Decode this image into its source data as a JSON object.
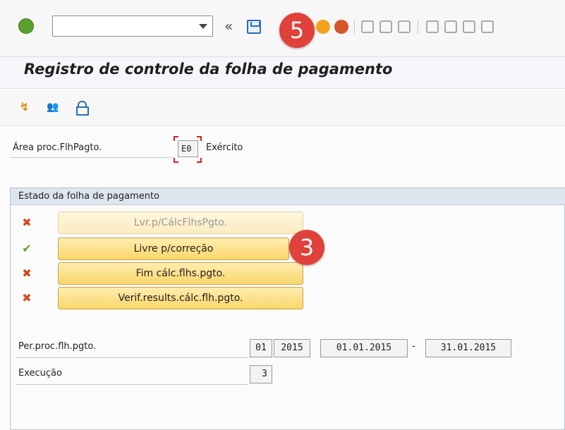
{
  "toolbar": {
    "command_field_value": "",
    "collapse_glyph": "«",
    "icons": [
      "enter-icon",
      "save-icon",
      "back-icon",
      "exit-icon",
      "cancel-icon",
      "print-icon",
      "find-icon",
      "find-next-icon",
      "first-page-icon",
      "previous-page-icon",
      "next-page-icon",
      "last-page-icon"
    ]
  },
  "title": "Registro de controle da folha de pagamento",
  "app_toolbar": {
    "icons": [
      "period-icon",
      "persons-icon",
      "lock-icon"
    ]
  },
  "payroll_area": {
    "label": "Área proc.FlhPagto.",
    "value": "E0",
    "description": "Exército"
  },
  "status_group": {
    "title": "Estado da folha de pagamento",
    "statuses": [
      {
        "label": "Lvr.p/CálcFlhsPgto.",
        "icon": "✖",
        "state": "inactive"
      },
      {
        "label": "Livre p/correção",
        "icon": "✔",
        "state": "active"
      },
      {
        "label": "Fim cálc.flhs.pgto.",
        "icon": "✖",
        "state": "inactive"
      },
      {
        "label": "Verif.results.cálc.flh.pgto.",
        "icon": "✖",
        "state": "inactive"
      }
    ]
  },
  "period": {
    "label": "Per.proc.flh.pgto.",
    "number": "01",
    "year": "2015",
    "from": "01.01.2015",
    "dash": "-",
    "to": "31.01.2015"
  },
  "execution": {
    "label": "Execução",
    "value": "3"
  },
  "badges": {
    "step5": "5",
    "step3": "3"
  },
  "colors": {
    "badge": "#e0413a",
    "button": "#fad66a",
    "error": "#d24a1a",
    "ok": "#5aa02c"
  }
}
